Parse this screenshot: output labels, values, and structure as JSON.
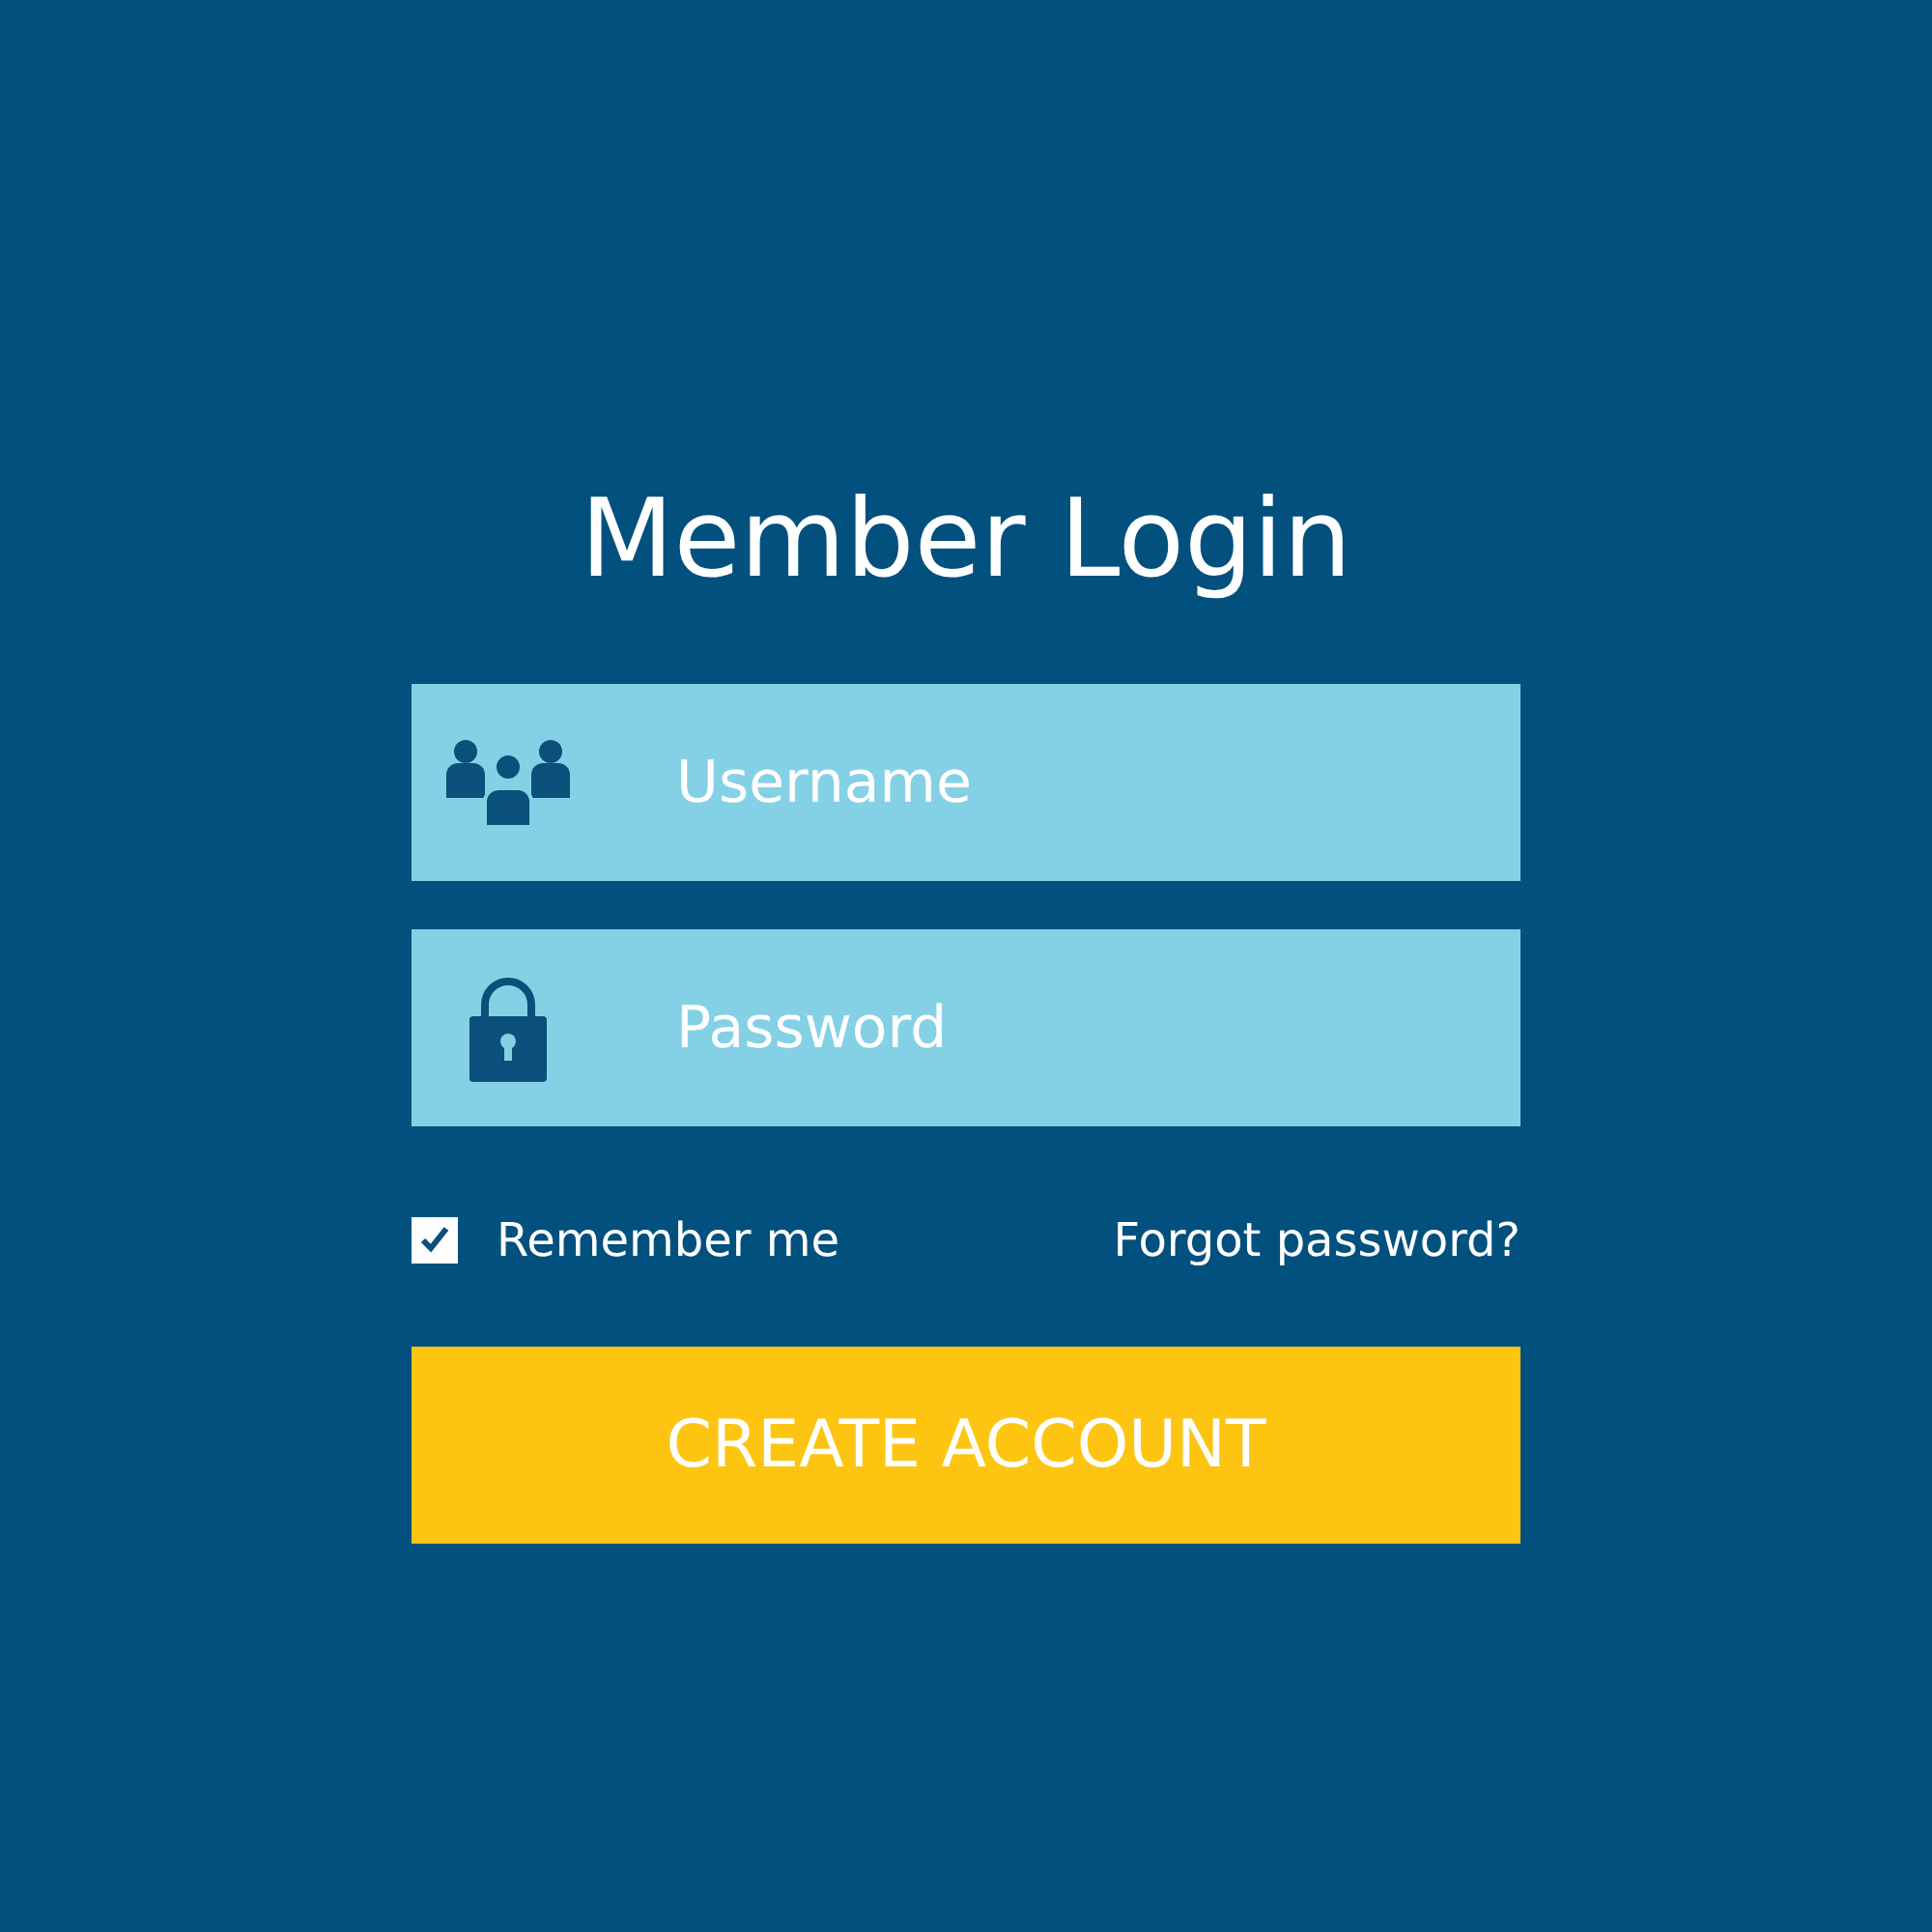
{
  "title": "Member Login",
  "fields": [
    {
      "kind": "username",
      "placeholder": "Username"
    },
    {
      "kind": "password",
      "placeholder": "Password"
    }
  ],
  "remember": {
    "label": "Remember me",
    "checked": true
  },
  "forgot_link": "Forgot password?",
  "button": "CREATE ACCOUNT"
}
